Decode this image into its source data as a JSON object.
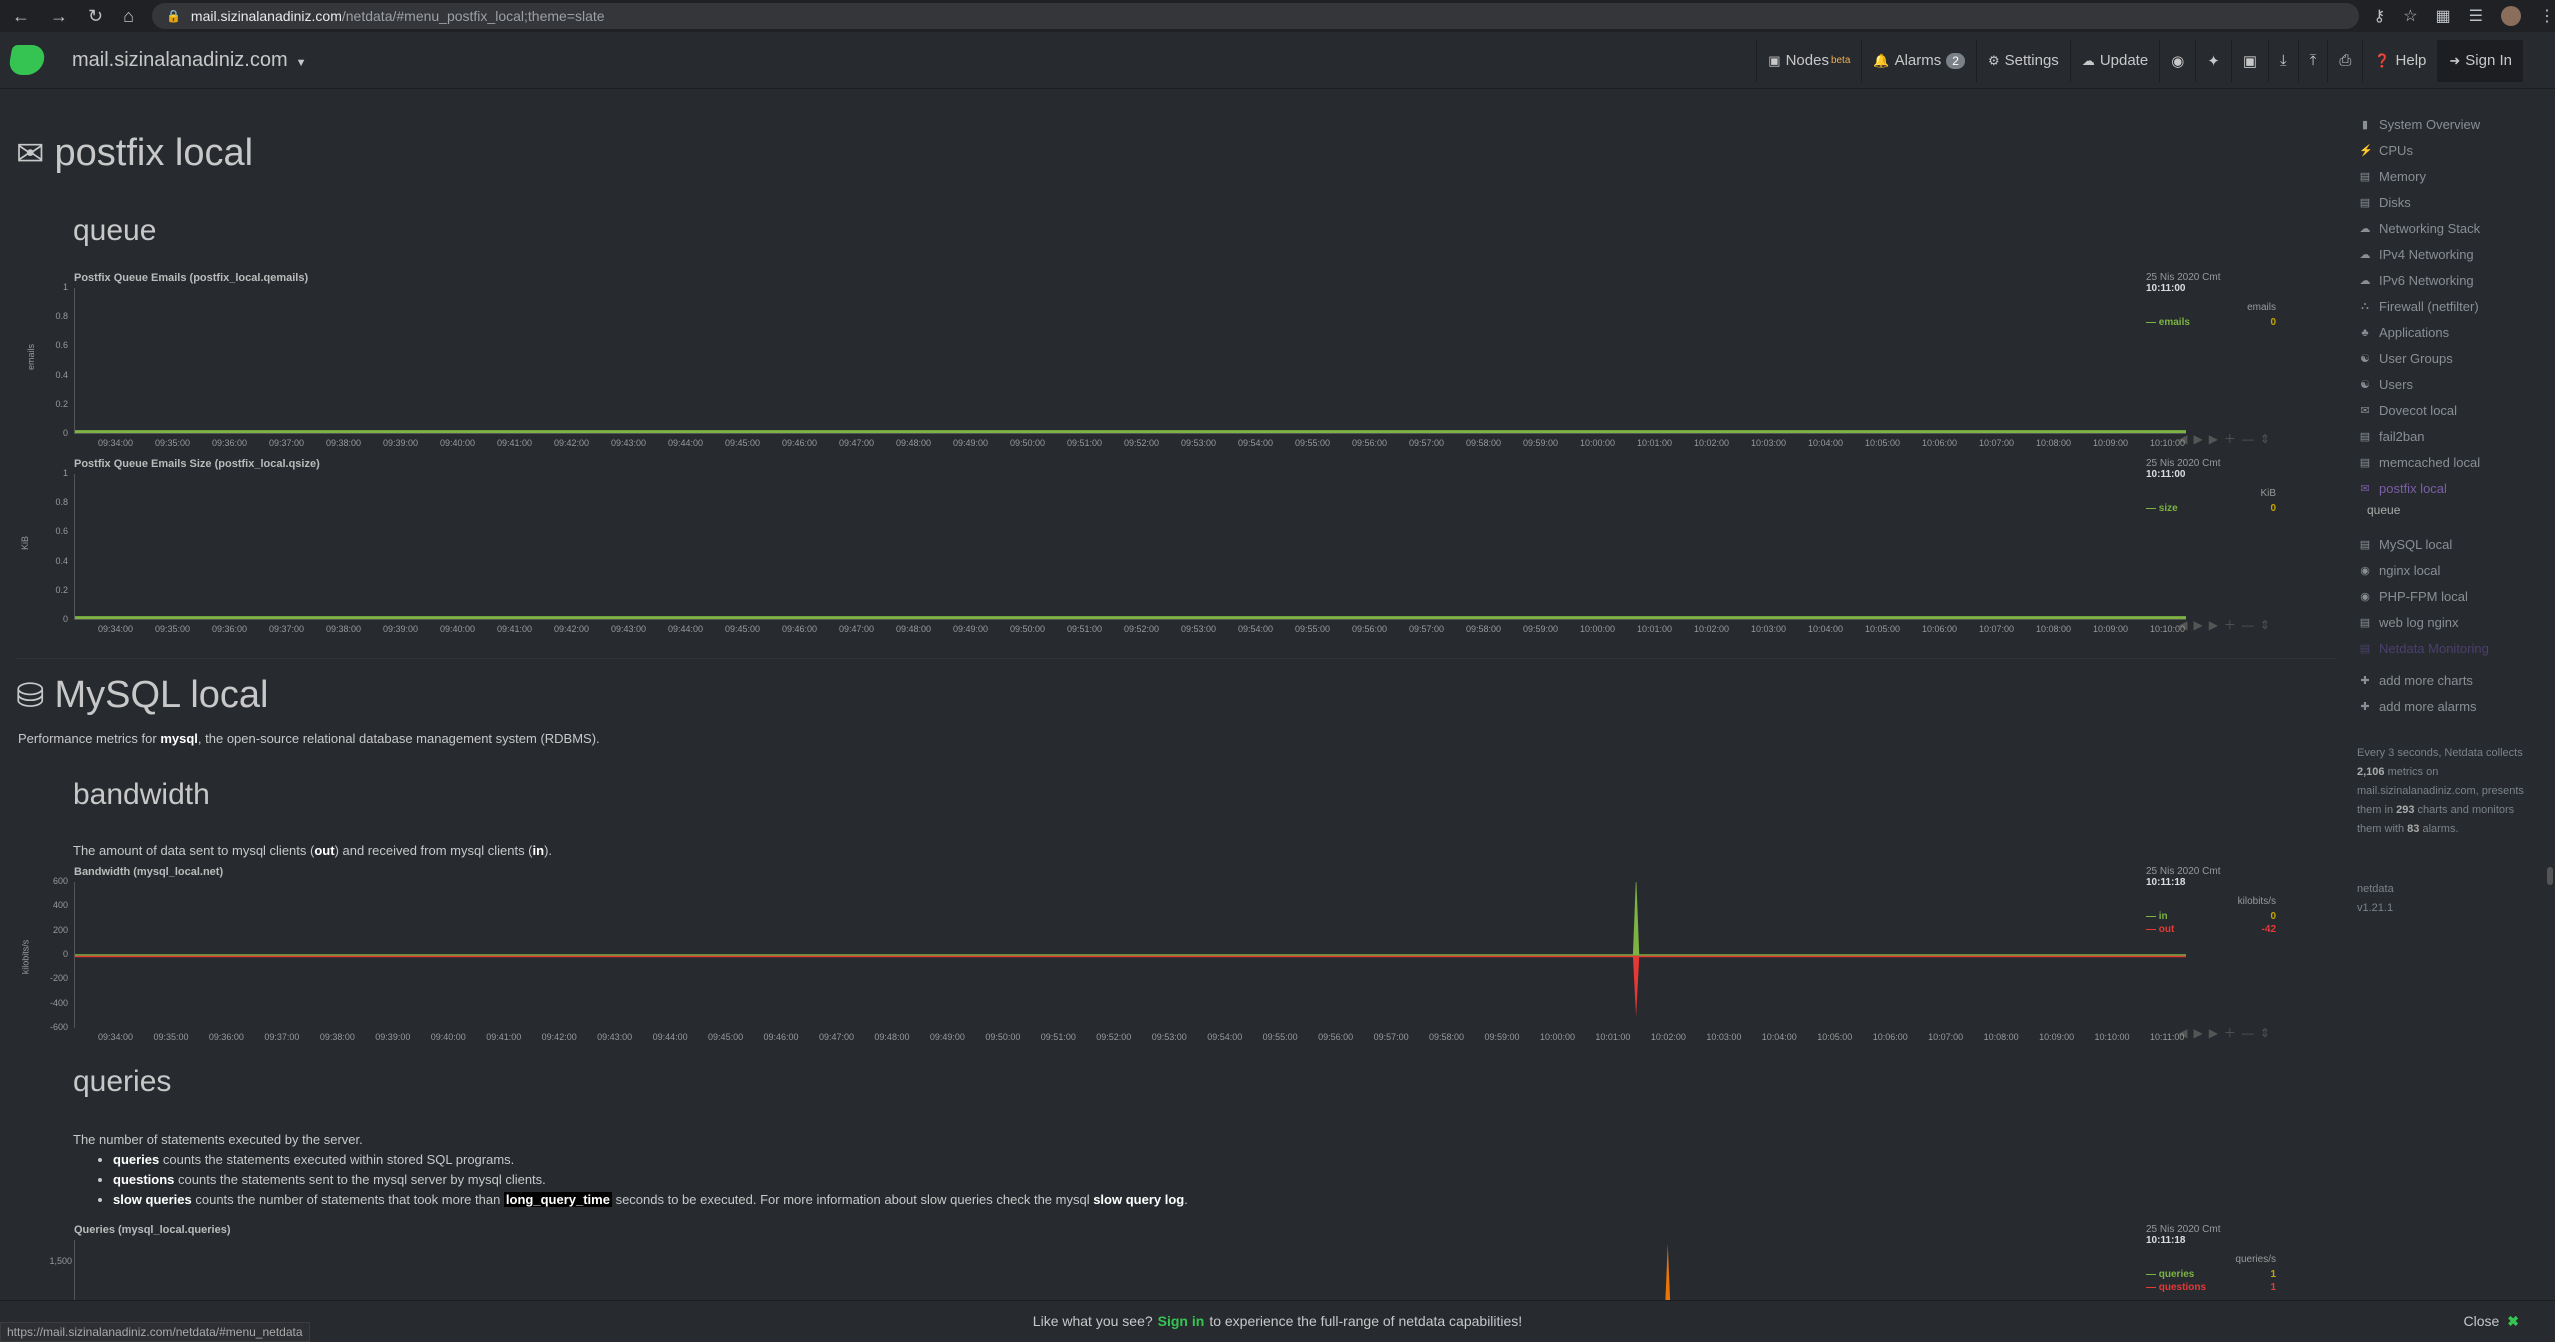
{
  "browser": {
    "url_host": "mail.sizinalanadiniz.com",
    "url_path": "/netdata/#menu_postfix_local;theme=slate"
  },
  "topbar": {
    "brand": "mail.sizinalanadiniz.com",
    "nodes": "Nodes",
    "nodes_sup": "beta",
    "alarms": "Alarms",
    "alarms_count": "2",
    "settings": "Settings",
    "update": "Update",
    "help": "Help",
    "signin": "Sign In"
  },
  "postfix": {
    "title": "postfix local",
    "queue_heading": "queue",
    "chart1": {
      "title": "Postfix Queue Emails (postfix_local.qemails)",
      "yaxis": "emails",
      "date": "25 Nis 2020 Cmt",
      "time": "10:11:00",
      "unit": "emails",
      "series": "emails",
      "value": "0"
    },
    "chart2": {
      "title": "Postfix Queue Emails Size (postfix_local.qsize)",
      "yaxis": "KiB",
      "date": "25 Nis 2020 Cmt",
      "time": "10:11:00",
      "unit": "KiB",
      "series": "size",
      "value": "0"
    }
  },
  "mysql": {
    "title": "MySQL local",
    "desc_pre": "Performance metrics for ",
    "desc_b": "mysql",
    "desc_post": ", the open-source relational database management system (RDBMS).",
    "bandwidth_heading": "bandwidth",
    "bw_pre": "The amount of data sent to mysql clients (",
    "bw_out": "out",
    "bw_mid": ") and received from mysql clients (",
    "bw_in": "in",
    "bw_post": ").",
    "chart3": {
      "title": "Bandwidth (mysql_local.net)",
      "yaxis": "kilobits/s",
      "date": "25 Nis 2020 Cmt",
      "time": "10:11:18",
      "unit": "kilobits/s",
      "s1": "in",
      "v1": "0",
      "s2": "out",
      "v2": "-42"
    },
    "queries_heading": "queries",
    "q_intro": "The number of statements executed by the server.",
    "q_b1": "queries",
    "q_t1": " counts the statements executed within stored SQL programs.",
    "q_b2": "questions",
    "q_t2": " counts the statements sent to the mysql server by mysql clients.",
    "q_b3": "slow queries",
    "q_t3a": " counts the number of statements that took more than ",
    "q_b3b": "long_query_time",
    "q_t3b": " seconds to be executed. For more information about slow queries check the mysql ",
    "q_b3c": "slow query log",
    "q_t3c": ".",
    "chart4": {
      "title": "Queries (mysql_local.queries)",
      "ytick": "1,500",
      "date": "25 Nis 2020 Cmt",
      "time": "10:11:18",
      "unit": "queries/s",
      "s1": "queries",
      "v1": "1",
      "s2": "questions",
      "v2": "1"
    }
  },
  "axis": {
    "ticks01": [
      "1",
      "0.8",
      "0.6",
      "0.4",
      "0.2",
      "0"
    ],
    "ticks_bw": [
      "600",
      "400",
      "200",
      "0",
      "-200",
      "-400",
      "-600"
    ],
    "xticks": [
      "09:34:00",
      "09:35:00",
      "09:36:00",
      "09:37:00",
      "09:38:00",
      "09:39:00",
      "09:40:00",
      "09:41:00",
      "09:42:00",
      "09:43:00",
      "09:44:00",
      "09:45:00",
      "09:46:00",
      "09:47:00",
      "09:48:00",
      "09:49:00",
      "09:50:00",
      "09:51:00",
      "09:52:00",
      "09:53:00",
      "09:54:00",
      "09:55:00",
      "09:56:00",
      "09:57:00",
      "09:58:00",
      "09:59:00",
      "10:00:00",
      "10:01:00",
      "10:02:00",
      "10:03:00",
      "10:04:00",
      "10:05:00",
      "10:06:00",
      "10:07:00",
      "10:08:00",
      "10:09:00",
      "10:10:00"
    ],
    "xticks_bw": [
      "09:34:00",
      "09:35:00",
      "09:36:00",
      "09:37:00",
      "09:38:00",
      "09:39:00",
      "09:40:00",
      "09:41:00",
      "09:42:00",
      "09:43:00",
      "09:44:00",
      "09:45:00",
      "09:46:00",
      "09:47:00",
      "09:48:00",
      "09:49:00",
      "09:50:00",
      "09:51:00",
      "09:52:00",
      "09:53:00",
      "09:54:00",
      "09:55:00",
      "09:56:00",
      "09:57:00",
      "09:58:00",
      "09:59:00",
      "10:00:00",
      "10:01:00",
      "10:02:00",
      "10:03:00",
      "10:04:00",
      "10:05:00",
      "10:06:00",
      "10:07:00",
      "10:08:00",
      "10:09:00",
      "10:10:00",
      "10:11:00"
    ]
  },
  "chart_data": [
    {
      "type": "line",
      "title": "Postfix Queue Emails (postfix_local.qemails)",
      "ylabel": "emails",
      "ylim": [
        0,
        1
      ],
      "series": [
        {
          "name": "emails",
          "values": [
            0,
            0
          ]
        }
      ]
    },
    {
      "type": "line",
      "title": "Postfix Queue Emails Size (postfix_local.qsize)",
      "ylabel": "KiB",
      "ylim": [
        0,
        1
      ],
      "series": [
        {
          "name": "size",
          "values": [
            0,
            0
          ]
        }
      ]
    },
    {
      "type": "line",
      "title": "Bandwidth (mysql_local.net)",
      "ylabel": "kilobits/s",
      "ylim": [
        -600,
        600
      ],
      "series": [
        {
          "name": "in",
          "spike_at": "10:02:00",
          "spike_value": 680
        },
        {
          "name": "out",
          "spike_at": "10:02:00",
          "spike_value": -500
        }
      ]
    }
  ],
  "sidebar": {
    "items": [
      "System Overview",
      "CPUs",
      "Memory",
      "Disks",
      "Networking Stack",
      "IPv4 Networking",
      "IPv6 Networking",
      "Firewall (netfilter)",
      "Applications",
      "User Groups",
      "Users",
      "Dovecot local",
      "fail2ban",
      "memcached local",
      "postfix local"
    ],
    "sub": "queue",
    "items2": [
      "MySQL local",
      "nginx local",
      "PHP-FPM local",
      "web log nginx",
      "Netdata Monitoring"
    ],
    "add_charts": "add more charts",
    "add_alarms": "add more alarms",
    "info_1": "Every 3 seconds, Netdata collects ",
    "info_b1": "2,106",
    "info_2": " metrics on mail.sizinalanadiniz.com, presents them in ",
    "info_b2": "293",
    "info_3": " charts and monitors them with ",
    "info_b3": "83",
    "info_4": " alarms.",
    "version_name": "netdata",
    "version": "v1.21.1"
  },
  "banner": {
    "pre": "Like what you see?",
    "sign": "Sign in",
    "post": "to experience the full-range of netdata capabilities!",
    "close": "Close"
  },
  "status_url": "https://mail.sizinalanadiniz.com/netdata/#menu_netdata",
  "colors": {
    "green": "#35c452",
    "in": "#7cb342",
    "out": "#e53935"
  }
}
